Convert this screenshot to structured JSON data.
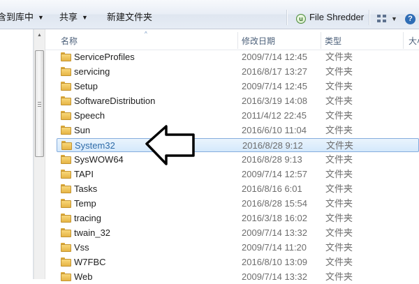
{
  "toolbar": {
    "include_in_library_label": "含到库中",
    "share_label": "共享",
    "new_folder_label": "新建文件夹",
    "file_shredder_label": "File Shredder"
  },
  "columns": {
    "name": "名称",
    "date_modified": "修改日期",
    "type": "类型",
    "size": "大小"
  },
  "files": [
    {
      "name": "ServiceProfiles",
      "date": "2009/7/14 12:45",
      "type": "文件夹"
    },
    {
      "name": "servicing",
      "date": "2016/8/17 13:27",
      "type": "文件夹"
    },
    {
      "name": "Setup",
      "date": "2009/7/14 12:45",
      "type": "文件夹"
    },
    {
      "name": "SoftwareDistribution",
      "date": "2016/3/19 14:08",
      "type": "文件夹"
    },
    {
      "name": "Speech",
      "date": "2011/4/12 22:45",
      "type": "文件夹"
    },
    {
      "name": "Sun",
      "date": "2016/6/10 11:04",
      "type": "文件夹"
    },
    {
      "name": "System32",
      "date": "2016/8/28 9:12",
      "type": "文件夹",
      "selected": true
    },
    {
      "name": "SysWOW64",
      "date": "2016/8/28 9:13",
      "type": "文件夹"
    },
    {
      "name": "TAPI",
      "date": "2009/7/14 12:57",
      "type": "文件夹"
    },
    {
      "name": "Tasks",
      "date": "2016/8/16 6:01",
      "type": "文件夹"
    },
    {
      "name": "Temp",
      "date": "2016/8/28 15:54",
      "type": "文件夹"
    },
    {
      "name": "tracing",
      "date": "2016/3/18 16:02",
      "type": "文件夹"
    },
    {
      "name": "twain_32",
      "date": "2009/7/14 13:32",
      "type": "文件夹"
    },
    {
      "name": "Vss",
      "date": "2009/7/14 11:20",
      "type": "文件夹"
    },
    {
      "name": "W7FBC",
      "date": "2016/8/10 13:09",
      "type": "文件夹"
    },
    {
      "name": "Web",
      "date": "2009/7/14 13:32",
      "type": "文件夹"
    }
  ],
  "icons": {
    "folder": "folder-icon",
    "shredder": "shredder-icon",
    "view": "view-options-icon",
    "help": "help-icon",
    "pointer": "pointer-arrow-icon"
  },
  "colors": {
    "selection_border": "#84acdd",
    "selection_text": "#2f6ca8",
    "folder": "#f8d77a"
  }
}
